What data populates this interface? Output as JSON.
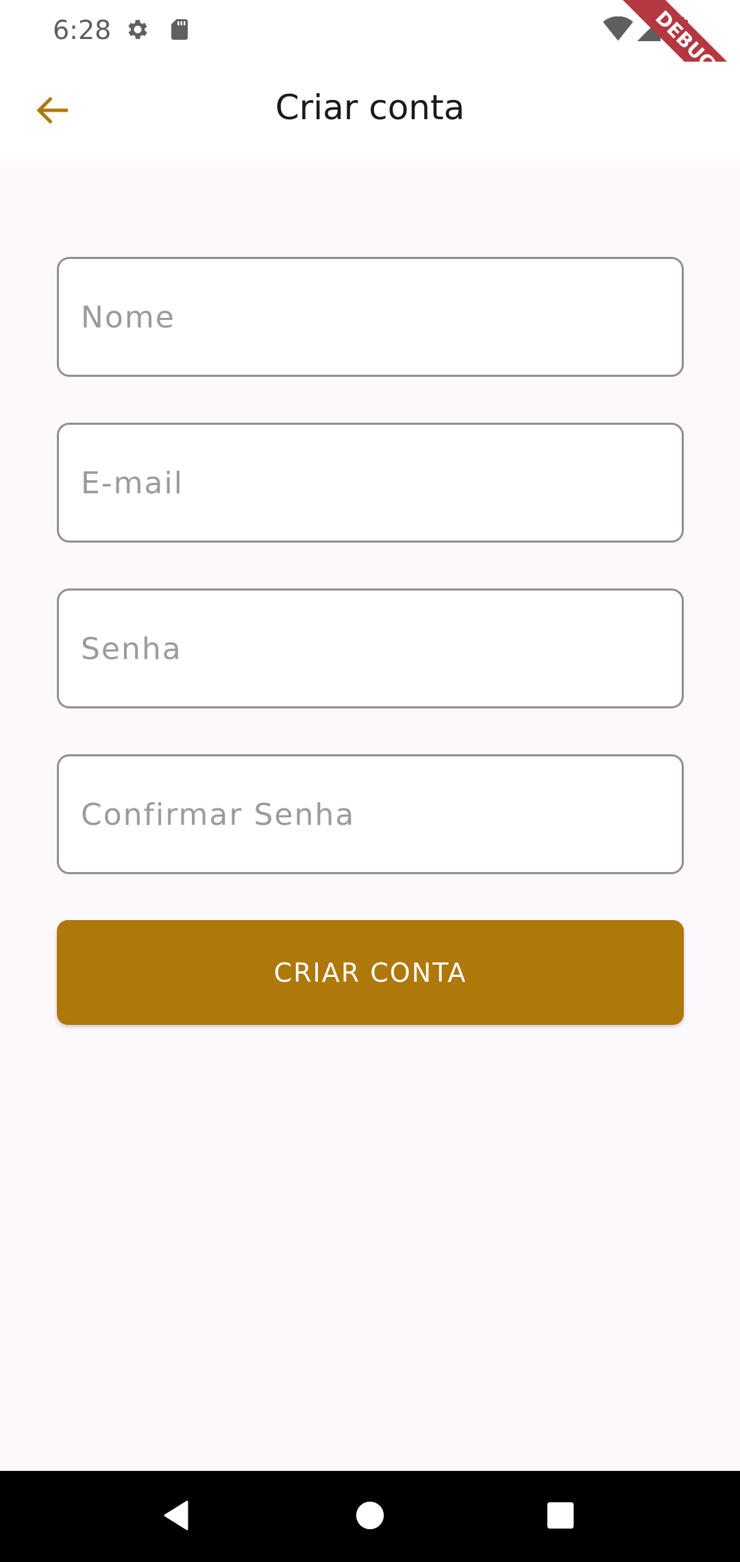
{
  "status_bar": {
    "time": "6:28",
    "icons": [
      "gear-icon",
      "sd-card-icon",
      "wifi-icon",
      "signal-icon",
      "battery-icon"
    ]
  },
  "debug_banner": "DEBUG",
  "app_bar": {
    "title": "Criar conta",
    "back_icon": "arrow-left-icon",
    "accent_color": "#ae780b"
  },
  "form": {
    "fields": [
      {
        "placeholder": "Nome",
        "value": ""
      },
      {
        "placeholder": "E-mail",
        "value": ""
      },
      {
        "placeholder": "Senha",
        "value": ""
      },
      {
        "placeholder": "Confirmar Senha",
        "value": ""
      }
    ],
    "submit_label": "CRIAR CONTA",
    "submit_color": "#ae780b"
  },
  "nav_bar": {
    "buttons": [
      "back-triangle-icon",
      "home-circle-icon",
      "recents-square-icon"
    ]
  }
}
